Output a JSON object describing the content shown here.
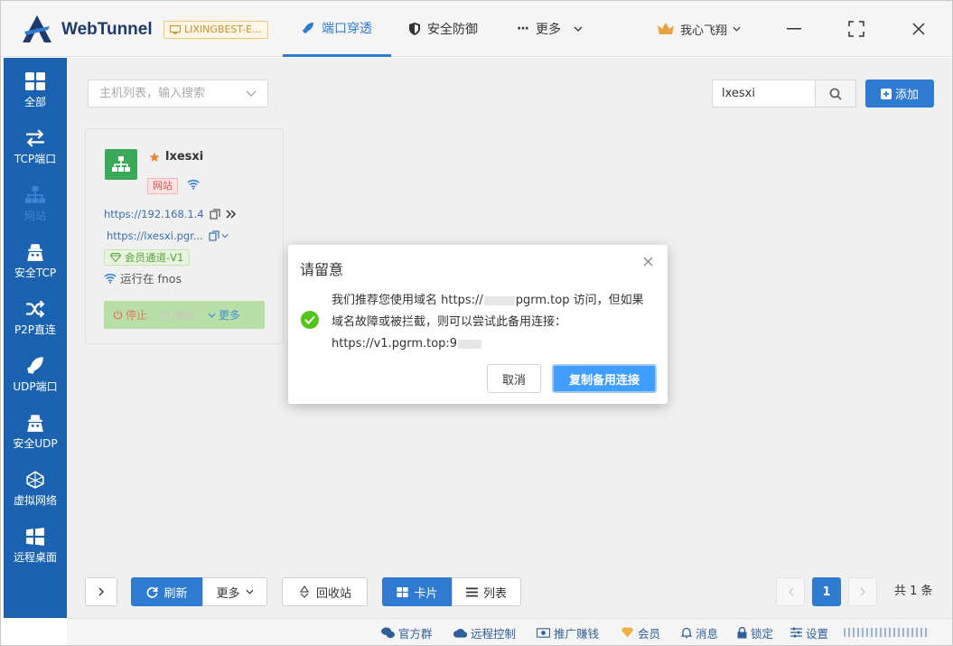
{
  "app": {
    "title": "WebTunnel",
    "device_badge": "LIXINGBEST-E..."
  },
  "topnav": {
    "items": [
      {
        "label": "端口穿透",
        "icon": "rocket-icon",
        "active": true
      },
      {
        "label": "安全防御",
        "icon": "shield-icon",
        "active": false
      },
      {
        "label": "更多",
        "icon": "dots-icon",
        "active": false
      }
    ],
    "user": "我心飞翔"
  },
  "sidebar": {
    "items": [
      {
        "label": "全部",
        "icon": "grid-icon"
      },
      {
        "label": "TCP端口",
        "icon": "swap-icon"
      },
      {
        "label": "网站",
        "icon": "sitemap-icon",
        "active": true
      },
      {
        "label": "安全TCP",
        "icon": "secure-icon"
      },
      {
        "label": "P2P直连",
        "icon": "shuffle-icon"
      },
      {
        "label": "UDP端口",
        "icon": "rocket-icon"
      },
      {
        "label": "安全UDP",
        "icon": "secure-icon"
      },
      {
        "label": "虚拟网络",
        "icon": "network-icon"
      },
      {
        "label": "远程桌面",
        "icon": "windows-icon"
      }
    ]
  },
  "toolbar": {
    "host_placeholder": "主机列表，输入搜索",
    "search_value": "lxesxi",
    "add_label": "添加"
  },
  "card": {
    "name": "lxesxi",
    "type_tag": "网站",
    "local_url": "https://192.168.1.4",
    "remote_url": "https://lxesxi.pgr...",
    "vip_tag": "会员通道-V1",
    "status": "运行在 fnos",
    "actions": {
      "stop": "停止",
      "edit": "编辑",
      "more": "更多"
    }
  },
  "bottom": {
    "refresh": "刷新",
    "more": "更多",
    "recycle": "回收站",
    "view_card": "卡片",
    "view_list": "列表",
    "current_page": "1",
    "total": "共 1 条"
  },
  "footer": {
    "items": [
      "官方群",
      "远程控制",
      "推广赚钱",
      "会员",
      "消息",
      "锁定",
      "设置"
    ]
  },
  "modal": {
    "title": "请留意",
    "text_line1_a": "我们推荐您使用域名 https://",
    "text_line1_b": "pgrm.top 访问，但如果",
    "text_line2": "域名故障或被拦截，则可以尝试此备用连接：",
    "text_line3": "https://v1.pgrm.top:9",
    "cancel": "取消",
    "copy": "复制备用连接"
  },
  "colors": {
    "primary": "#2f7bd1",
    "sidebar": "#1b63b0",
    "success": "#52c41a"
  }
}
